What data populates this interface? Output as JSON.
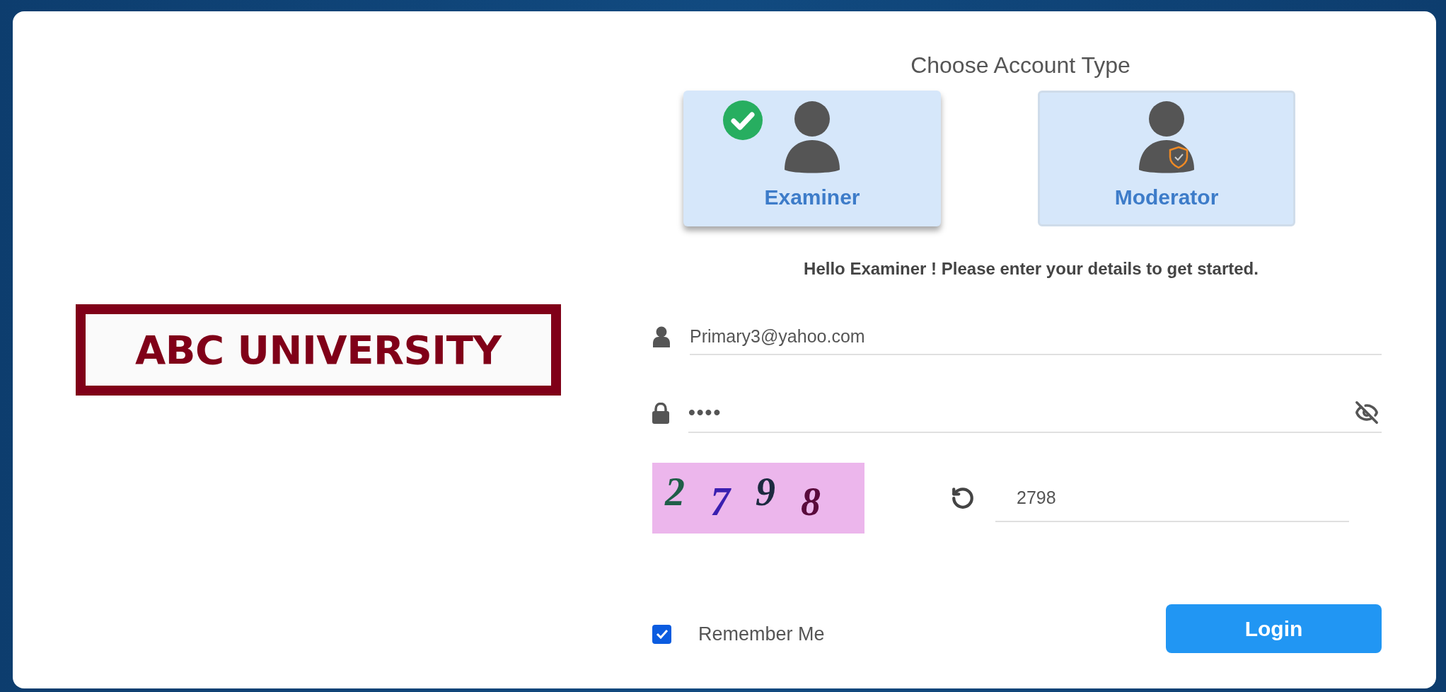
{
  "logo": {
    "text": "ABC UNIVERSITY"
  },
  "account_chooser": {
    "title": "Choose Account Type",
    "options": [
      {
        "label": "Examiner",
        "kind": "plain",
        "selected": true
      },
      {
        "label": "Moderator",
        "kind": "shielded",
        "selected": false
      }
    ]
  },
  "greeting": "Hello Examiner ! Please enter your details to get started.",
  "email": {
    "value": "Primary3@yahoo.com"
  },
  "password": {
    "value": "••••"
  },
  "captcha": {
    "characters": [
      {
        "text": "2",
        "color": "#1f5e48"
      },
      {
        "text": "7",
        "color": "#3a1fb0"
      },
      {
        "text": "9",
        "color": "#1c2a40"
      },
      {
        "text": "8",
        "color": "#5a0a3c"
      }
    ],
    "answer": "2798"
  },
  "remember_me": {
    "label": "Remember Me",
    "checked": true
  },
  "login_button": "Login"
}
